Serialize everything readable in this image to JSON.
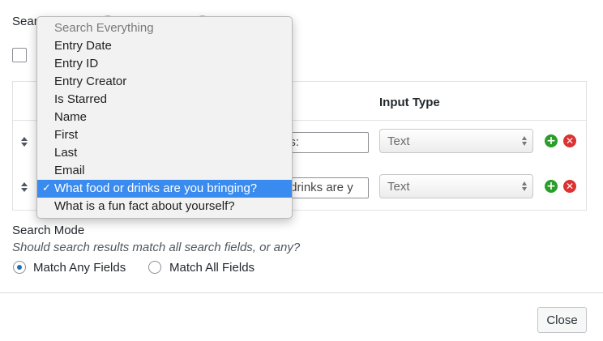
{
  "top": {
    "search_layout_label": "Search Layout"
  },
  "table": {
    "header_input_type": "Input Type",
    "rows": [
      {
        "label_value": "es:",
        "input_type": "Text",
        "add_label": "+",
        "remove_label": "✕"
      },
      {
        "label_value": "r drinks are y",
        "input_type": "Text",
        "add_label": "+",
        "remove_label": "✕"
      }
    ]
  },
  "dropdown": {
    "items": [
      {
        "label": "Search Everything",
        "state": "disabled"
      },
      {
        "label": "Entry Date"
      },
      {
        "label": "Entry ID"
      },
      {
        "label": "Entry Creator"
      },
      {
        "label": "Is Starred"
      },
      {
        "label": "Name"
      },
      {
        "label": "First"
      },
      {
        "label": "Last"
      },
      {
        "label": "Email"
      },
      {
        "label": "What food or drinks are you bringing?",
        "state": "selected",
        "check": "✓"
      },
      {
        "label": "What is a fun fact about yourself?"
      }
    ]
  },
  "search_mode": {
    "title": "Search Mode",
    "description": "Should search results match all search fields, or any?",
    "options": [
      {
        "label": "Match Any Fields",
        "checked": true
      },
      {
        "label": "Match All Fields",
        "checked": false
      }
    ]
  },
  "footer": {
    "close_label": "Close"
  },
  "colors": {
    "accent": "#2271b1",
    "selected_item": "#3a8bef",
    "add_icon": "#2a9d2a",
    "remove_icon": "#dc3232"
  }
}
